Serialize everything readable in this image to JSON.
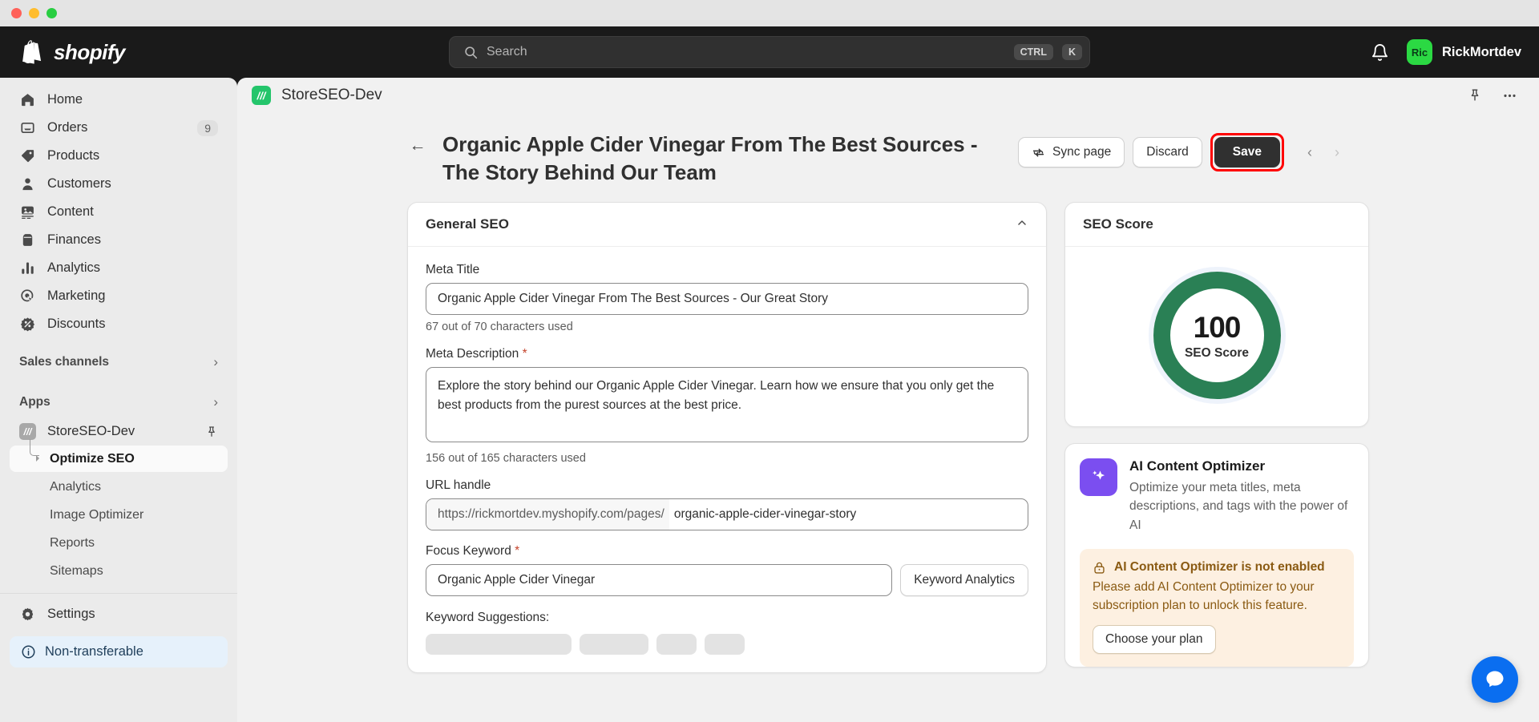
{
  "window": {
    "traffic_lights": [
      "close",
      "minimize",
      "zoom"
    ]
  },
  "topbar": {
    "brand": "shopify",
    "search": {
      "placeholder": "Search",
      "shortcut_ctrl": "CTRL",
      "shortcut_key": "K"
    },
    "notifications_icon": "bell-icon",
    "user": {
      "avatar_initials": "Ric",
      "name": "RickMortdev"
    }
  },
  "sidebar": {
    "items": [
      {
        "label": "Home",
        "icon": "home-icon",
        "badge": ""
      },
      {
        "label": "Orders",
        "icon": "orders-icon",
        "badge": "9"
      },
      {
        "label": "Products",
        "icon": "products-tag-icon",
        "badge": ""
      },
      {
        "label": "Customers",
        "icon": "customers-icon",
        "badge": ""
      },
      {
        "label": "Content",
        "icon": "content-icon",
        "badge": ""
      },
      {
        "label": "Finances",
        "icon": "finances-icon",
        "badge": ""
      },
      {
        "label": "Analytics",
        "icon": "analytics-bars-icon",
        "badge": ""
      },
      {
        "label": "Marketing",
        "icon": "marketing-target-icon",
        "badge": ""
      },
      {
        "label": "Discounts",
        "icon": "discounts-percent-icon",
        "badge": ""
      }
    ],
    "sales_channels_label": "Sales channels",
    "apps_label": "Apps",
    "app": {
      "name": "StoreSEO-Dev",
      "icon": "storeseo-app-icon",
      "pin_icon": "pin-icon"
    },
    "app_subitems": [
      {
        "label": "Optimize SEO",
        "active": true
      },
      {
        "label": "Analytics",
        "active": false
      },
      {
        "label": "Image Optimizer",
        "active": false
      },
      {
        "label": "Reports",
        "active": false
      },
      {
        "label": "Sitemaps",
        "active": false
      }
    ],
    "settings_label": "Settings",
    "settings_icon": "gear-icon",
    "non_transferable": {
      "label": "Non-transferable",
      "icon": "info-circle-icon"
    }
  },
  "app_header": {
    "icon": "storeseo-app-icon",
    "title": "StoreSEO-Dev",
    "pin_icon": "pin-icon",
    "more_icon": "ellipsis-icon"
  },
  "page": {
    "back_icon": "arrow-left-icon",
    "title": "Organic Apple Cider Vinegar From The Best Sources - The Story Behind Our Team",
    "actions": {
      "sync_label": "Sync page",
      "sync_icon": "sync-icon",
      "discard_label": "Discard",
      "save_label": "Save",
      "prev_icon": "chevron-left-icon",
      "next_icon": "chevron-right-icon"
    }
  },
  "general_seo": {
    "card_title": "General SEO",
    "collapse_icon": "chevron-up-icon",
    "meta_title": {
      "label": "Meta Title",
      "value": "Organic Apple Cider Vinegar From The Best Sources - Our Great Story",
      "helper": "67 out of 70 characters used"
    },
    "meta_description": {
      "label": "Meta Description",
      "required": "*",
      "value": "Explore the story behind our Organic Apple Cider Vinegar. Learn how we ensure that you only get the best products from the purest sources at the best price.",
      "helper": "156 out of 165 characters used"
    },
    "url_handle": {
      "label": "URL handle",
      "prefix": "https://rickmortdev.myshopify.com/pages/",
      "value": "organic-apple-cider-vinegar-story"
    },
    "focus_keyword": {
      "label": "Focus Keyword",
      "required": "*",
      "value": "Organic Apple Cider Vinegar",
      "analytics_button": "Keyword Analytics"
    },
    "keyword_suggestions_label": "Keyword Suggestions:"
  },
  "seo_score": {
    "card_title": "SEO Score",
    "value": "100",
    "caption": "SEO Score",
    "ring_color": "#2a8055",
    "percent": 100
  },
  "ai_optimizer": {
    "icon": "ai-sparkle-icon",
    "title": "AI Content Optimizer",
    "description": "Optimize your meta titles, meta descriptions, and tags with the power of AI",
    "banner": {
      "icon": "lock-icon",
      "heading": "AI Content Optimizer is not enabled",
      "body": "Please add AI Content Optimizer to your subscription plan to unlock this feature.",
      "button": "Choose your plan"
    }
  },
  "chat": {
    "icon": "chat-bubble-icon",
    "color": "#0a6ef0"
  }
}
